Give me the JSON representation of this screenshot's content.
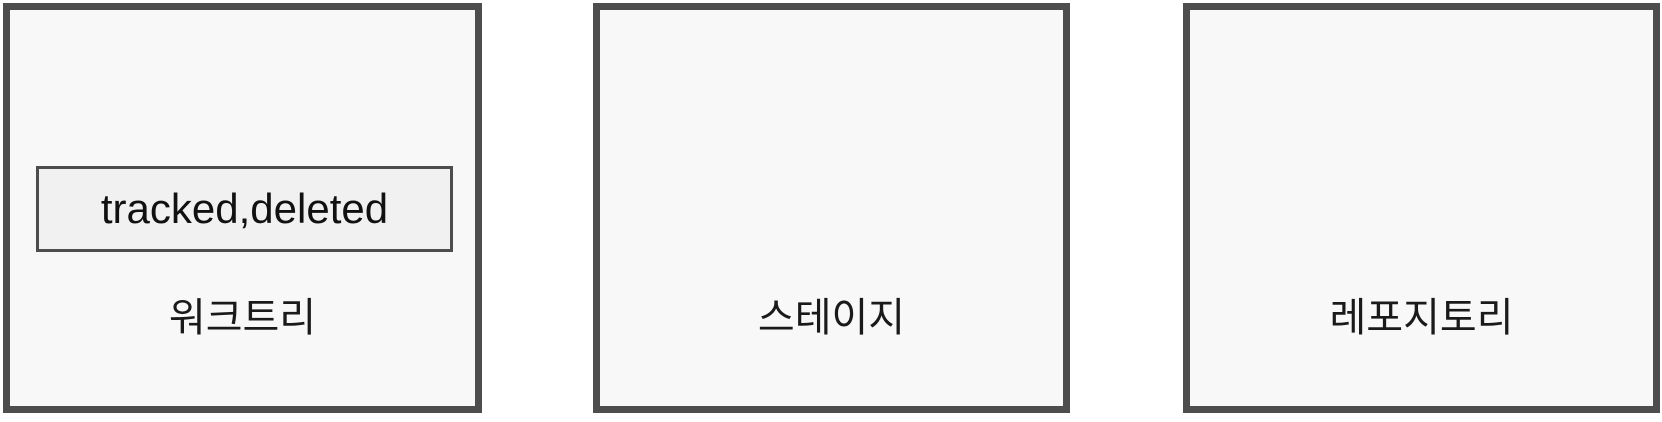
{
  "panels": {
    "worktree": {
      "label": "워크트리",
      "files": [
        {
          "label": "tracked,deleted"
        }
      ]
    },
    "stage": {
      "label": "스테이지"
    },
    "repository": {
      "label": "레포지토리"
    }
  },
  "colors": {
    "border": "#4d4d4d",
    "panel_fill": "#f8f8f8",
    "file_fill": "#f1f1f1",
    "text": "#1a1a1a"
  }
}
